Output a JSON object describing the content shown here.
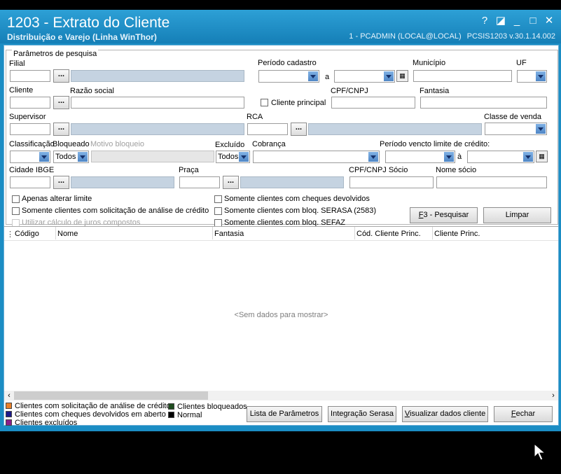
{
  "window": {
    "title": "1203 - Extrato do Cliente",
    "subtitle": "Distribuição e Varejo (Linha WinThor)",
    "user_info": "1 - PCADMIN (LOCAL@LOCAL)",
    "version": "PCSIS1203  v.30.1.14.002",
    "buttons": {
      "help": "?",
      "restore": "◪",
      "minimize": "_",
      "maximize": "□",
      "close": "✕"
    }
  },
  "params": {
    "group_title": "Parâmetros de pesquisa",
    "filial": "Filial",
    "periodo_cadastro": "Período cadastro",
    "a": "a",
    "municipio": "Município",
    "uf": "UF",
    "cliente": "Cliente",
    "razao_social": "Razão social",
    "cliente_principal": "Cliente principal",
    "cpf_cnpj": "CPF/CNPJ",
    "fantasia": "Fantasia",
    "supervisor": "Supervisor",
    "rca": "RCA",
    "classe_venda": "Classe de venda",
    "classificacao": "Classificação",
    "bloqueado": "Bloqueado",
    "bloqueado_value": "Todos",
    "motivo_bloqueio": "Motivo bloqueio",
    "excluido": "Excluído",
    "excluido_value": "Todos",
    "cobranca": "Cobrança",
    "periodo_vencto": "Período vencto limite de crédito:",
    "a2": "à",
    "cidade_ibge": "Cidade IBGE",
    "praca": "Praça",
    "cpf_cnpj_socio": "CPF/CNPJ Sócio",
    "nome_socio": "Nome sócio",
    "dots": "...",
    "checks": {
      "apenas_alterar": "Apenas alterar limite",
      "solicitacao": "Somente clientes com solicitação de análise de crédito",
      "juros": "Utilizar cálculo de juros compostos",
      "cheques": "Somente clientes com cheques devolvidos",
      "serasa": "Somente clientes com bloq. SERASA (2583)",
      "sefaz": "Somente clientes com bloq. SEFAZ"
    },
    "btn_pesquisar": "F3 - Pesquisar",
    "btn_limpar": "Limpar"
  },
  "grid": {
    "columns": [
      "Código",
      "Nome",
      "Fantasia",
      "Cód. Cliente Princ.",
      "Cliente Princ."
    ],
    "empty": "<Sem dados para mostrar>"
  },
  "legend": [
    {
      "label": "Clientes com solicitação de análise de crédito",
      "color": "#e8802a"
    },
    {
      "label": "Clientes com cheques devolvidos em aberto",
      "color": "#1c1a8a"
    },
    {
      "label": "Clientes excluídos",
      "color": "#8a1f8a"
    },
    {
      "label": "Clientes bloqueados",
      "color": "#1f4d1f"
    },
    {
      "label": "Normal",
      "color": "#000000"
    }
  ],
  "footer": {
    "lista": "Lista de Parâmetros",
    "serasa": "Integração Serasa",
    "visualizar": "Visualizar dados cliente",
    "fechar": "Fechar"
  }
}
